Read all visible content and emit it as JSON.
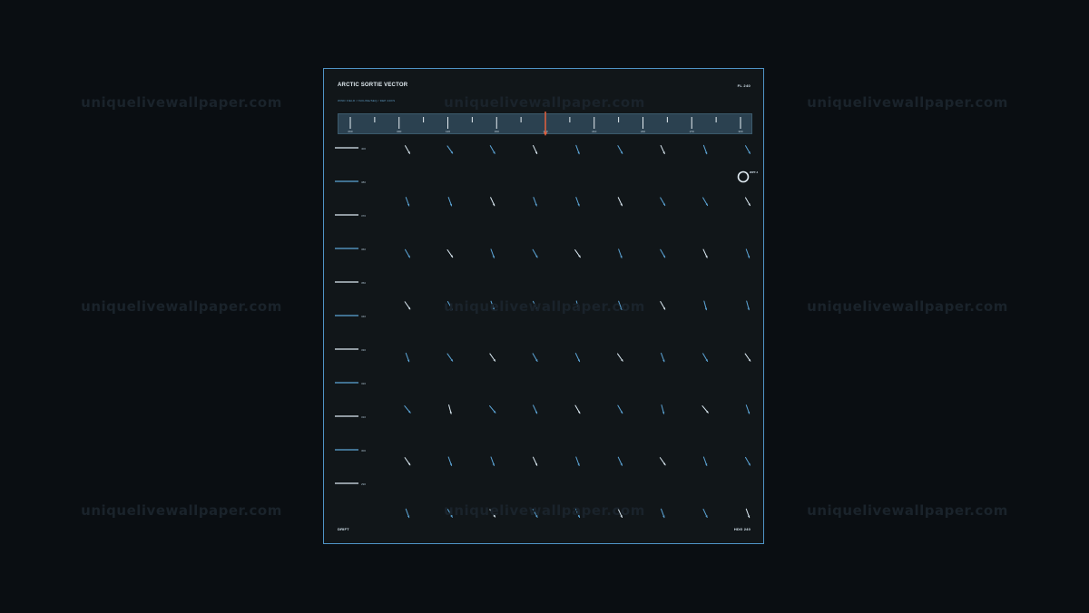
{
  "header": {
    "title": "ARCTIC SORTIE VECTOR",
    "flight_level": "FL 240",
    "subtitle": "WIND FIELD  /  ISOLINE/SEQ  /  DEP 240/S"
  },
  "ruler": {
    "labels": [
      "060",
      "090",
      "120",
      "150",
      "180",
      "210",
      "240",
      "270",
      "300"
    ],
    "needle_fraction": 0.5,
    "needle_color": "#e5603e"
  },
  "altitude_scale": {
    "labels": [
      "400",
      "380",
      "370",
      "360",
      "350",
      "340",
      "330",
      "320",
      "310",
      "300",
      "290"
    ],
    "highlighted": [
      true,
      false,
      true,
      false,
      true,
      false,
      true,
      false,
      true,
      false,
      true
    ]
  },
  "wind_field": {
    "columns": 9,
    "rows": 8,
    "headings": [
      [
        150,
        145,
        150,
        155,
        160,
        150,
        155,
        160,
        150
      ],
      [
        160,
        160,
        155,
        160,
        160,
        155,
        150,
        150,
        150
      ],
      [
        150,
        145,
        160,
        150,
        145,
        160,
        150,
        155,
        160
      ],
      [
        145,
        150,
        160,
        155,
        165,
        160,
        150,
        165,
        165
      ],
      [
        160,
        145,
        145,
        150,
        155,
        145,
        160,
        150,
        145
      ],
      [
        140,
        165,
        140,
        155,
        150,
        150,
        165,
        140,
        160
      ],
      [
        145,
        160,
        160,
        155,
        160,
        155,
        145,
        160,
        150
      ],
      [
        160,
        150,
        145,
        150,
        155,
        155,
        160,
        155,
        160
      ]
    ],
    "bright": [
      [
        true,
        false,
        false,
        true,
        false,
        false,
        true,
        false,
        false
      ],
      [
        false,
        false,
        true,
        false,
        false,
        true,
        false,
        false,
        true
      ],
      [
        false,
        true,
        false,
        false,
        true,
        false,
        false,
        true,
        false
      ],
      [
        true,
        false,
        false,
        false,
        false,
        false,
        true,
        false,
        false
      ],
      [
        false,
        false,
        true,
        false,
        false,
        true,
        false,
        false,
        true
      ],
      [
        false,
        true,
        false,
        false,
        true,
        false,
        false,
        true,
        false
      ],
      [
        true,
        false,
        false,
        true,
        false,
        false,
        true,
        false,
        false
      ],
      [
        false,
        false,
        true,
        false,
        false,
        true,
        false,
        false,
        true
      ]
    ],
    "colors": {
      "bright": "#dceaf3",
      "dim": "#5da6d8"
    }
  },
  "marker": {
    "label": "WPT-4",
    "row_fraction": 0.5
  },
  "footer": {
    "left": "DRIFT",
    "right": "HDG 240"
  },
  "watermark": "uniquelivewallpaper.com"
}
